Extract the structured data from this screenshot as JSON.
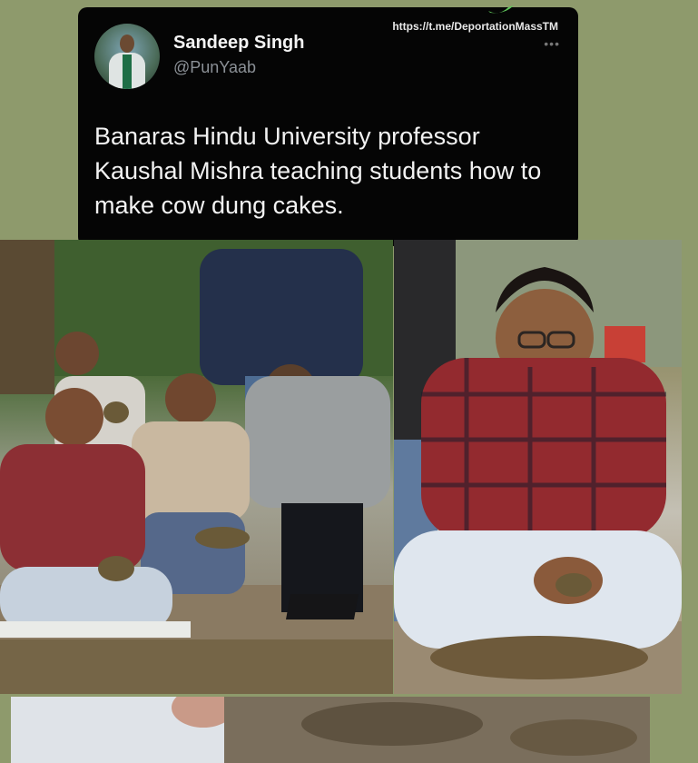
{
  "tweet": {
    "author_name": "Sandeep Singh",
    "author_handle": "@PunYaab",
    "text": "Banaras Hindu University professor Kaushal Mishra teaching students how to make cow dung cakes.",
    "watermark": "https://t.me/DeportationMassTM",
    "more_icon": "ellipsis-icon"
  },
  "colors": {
    "background": "#8e9a6c",
    "card": "#050505",
    "text_primary": "#f2f2f2",
    "text_secondary": "#8b9096"
  }
}
